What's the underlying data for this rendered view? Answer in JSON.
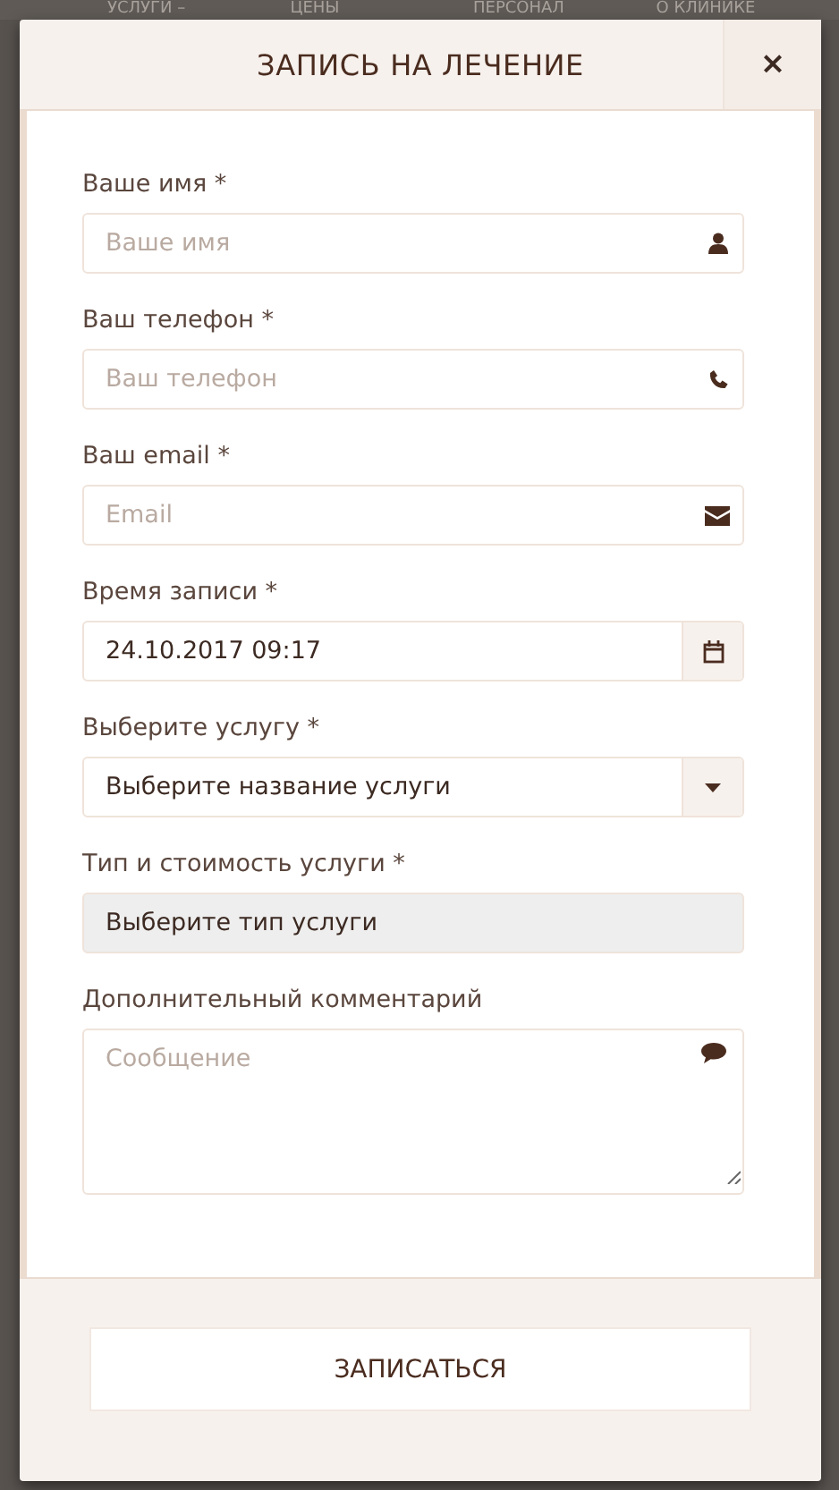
{
  "background_nav": [
    "УСЛУГИ –",
    "ЦЕНЫ",
    "ПЕРСОНАЛ",
    "О КЛИНИКЕ"
  ],
  "modal": {
    "title": "ЗАПИСЬ НА ЛЕЧЕНИЕ",
    "close": "×",
    "fields": [
      {
        "kind": "person",
        "label": "Ваше имя *",
        "placeholder": "Ваше имя",
        "disabled": false
      },
      {
        "kind": "phone",
        "label": "Ваш телефон *",
        "placeholder": "Ваш телефон",
        "disabled": false
      },
      {
        "kind": "email",
        "label": "Ваш email *",
        "placeholder": "Email",
        "disabled": false
      },
      {
        "kind": "datetime",
        "label": "Время записи *",
        "value": "24.10.2017 09:17",
        "disabled": false
      },
      {
        "kind": "select",
        "label": "Выберите услугу *",
        "value": "Выберите название услуги",
        "disabled": false
      },
      {
        "kind": "select-plain",
        "label": "Тип и стоимость услуги *",
        "value": "Выберите тип услуги",
        "disabled": true
      },
      {
        "kind": "textarea",
        "label": "Дополнительный комментарий",
        "placeholder": "Сообщение",
        "disabled": false
      }
    ],
    "submit": "ЗАПИСАТЬСЯ"
  }
}
